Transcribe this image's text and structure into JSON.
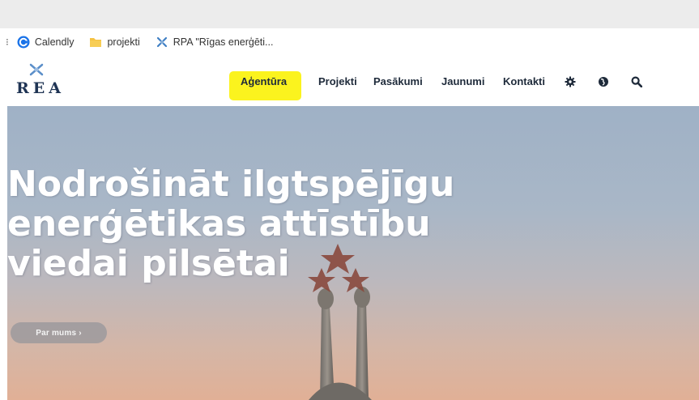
{
  "browser": {
    "bookmarks": [
      {
        "label": "Calendly",
        "icon": "calendly-icon"
      },
      {
        "label": "projekti",
        "icon": "folder-icon"
      },
      {
        "label": "RPA \"Rīgas enerģēti...",
        "icon": "rea-favicon-icon"
      }
    ]
  },
  "site": {
    "logo_text": "REA",
    "nav": {
      "items": [
        "Aģentūra",
        "Projekti",
        "Pasākumi",
        "Jaunumi",
        "Kontakti"
      ],
      "highlight_color": "#fbf31e",
      "icons": [
        "gear-icon",
        "globe-icon",
        "search-icon"
      ]
    },
    "hero": {
      "heading": "Nodrošināt ilgtspējīgu\nenerģētikas attīstību\nviedai pilsētai",
      "button_label": "Par mums ›"
    }
  }
}
